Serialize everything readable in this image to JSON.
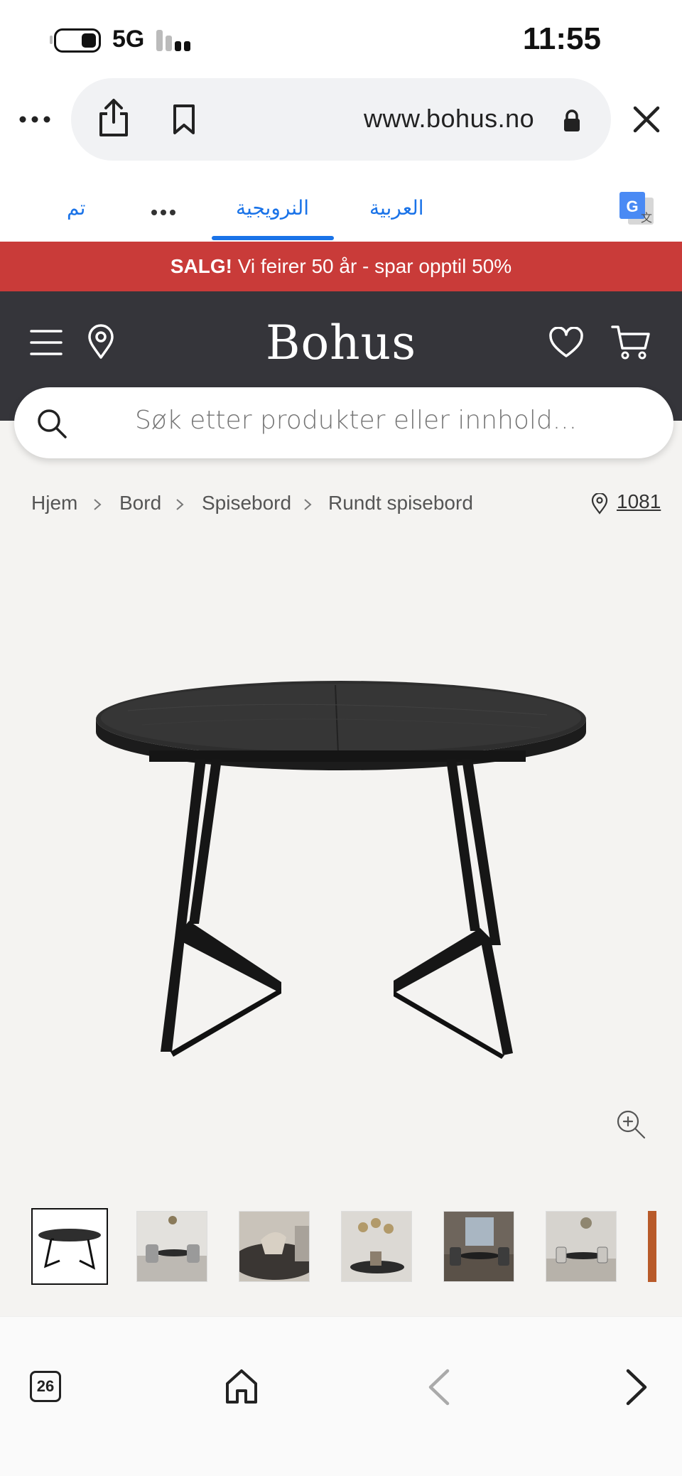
{
  "status": {
    "network": "5G",
    "time": "11:55"
  },
  "browser": {
    "url": "www.bohus.no",
    "tab_count": "26"
  },
  "translate": {
    "done": "تم",
    "lang_norwegian": "النرويجية",
    "lang_arabic": "العربية"
  },
  "banner": {
    "bold": "SALG!",
    "text": " Vi feirer 50 år - spar opptil 50%"
  },
  "header": {
    "logo": "Bohus"
  },
  "search": {
    "placeholder": "Søk etter produkter eller innhold..."
  },
  "breadcrumb": {
    "items": [
      "Hjem",
      "Bord",
      "Spisebord",
      "Rundt spisebord"
    ],
    "store": "1081"
  },
  "colors": {
    "sale": "#c93b39",
    "header": "#35353a",
    "translate_blue": "#1a73e8",
    "page_bg": "#f4f3f1"
  }
}
